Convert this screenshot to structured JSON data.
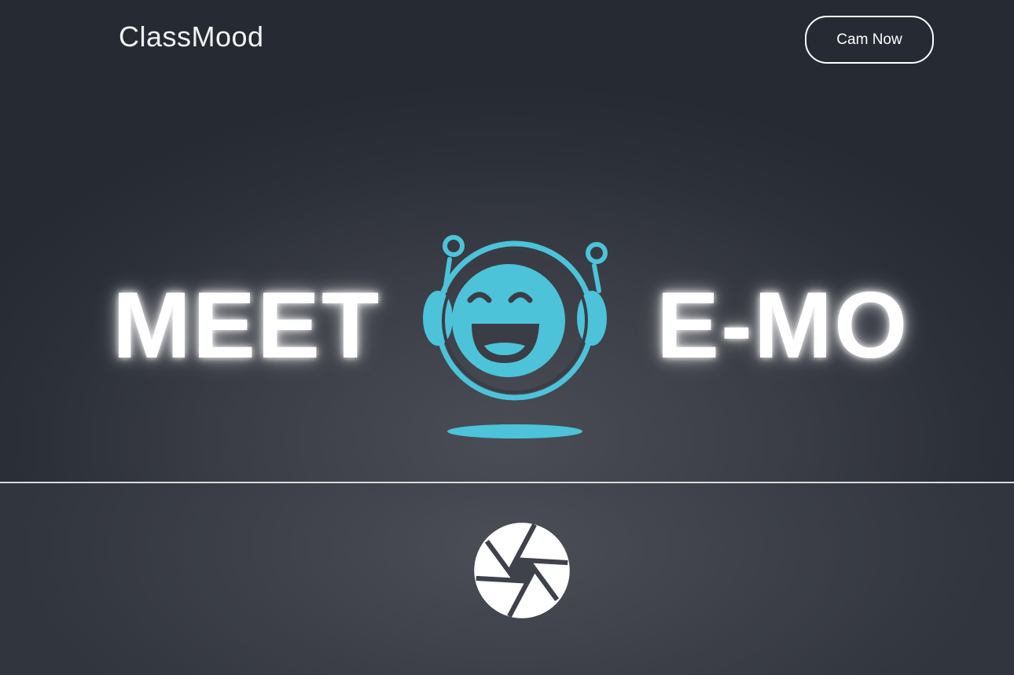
{
  "header": {
    "brand": "ClassMood",
    "cta_label": "Cam Now"
  },
  "hero": {
    "word_left": "MEET",
    "word_right": "E-MO",
    "mascot_icon": "smiling-robot-icon"
  },
  "capture": {
    "icon": "camera-shutter-icon"
  },
  "colors": {
    "accent": "#4cc3d9",
    "text": "#ffffff",
    "background": "#2b2f37"
  }
}
